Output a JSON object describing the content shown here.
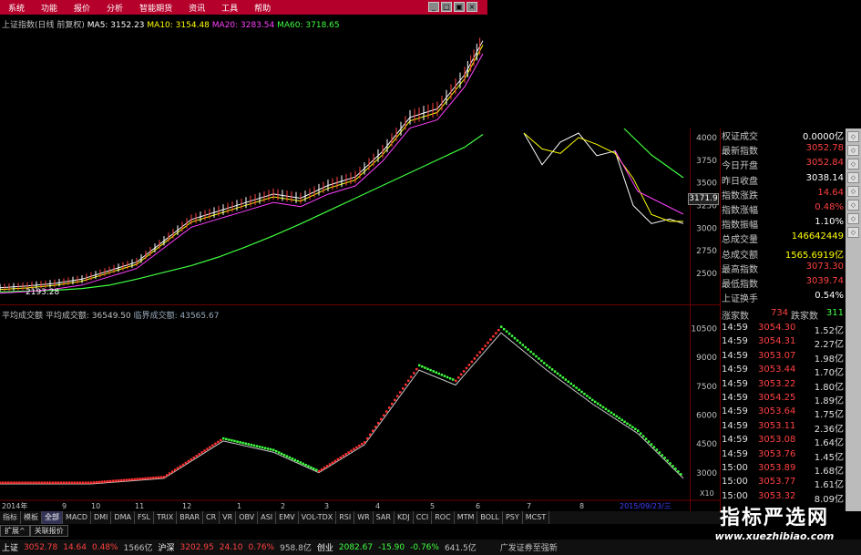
{
  "menu": [
    "系统",
    "功能",
    "报价",
    "分析",
    "智能期货",
    "资讯",
    "工具",
    "帮助"
  ],
  "main_legend": {
    "index": "上证指数(日线 前复权)",
    "ma5": "MA5: 3152.23",
    "ma10": "MA10: 3154.48",
    "ma20": "MA20: 3283.54",
    "ma60": "MA60: 3718.65",
    "low_label": "2193.28",
    "colors": {
      "ma5": "#ffffff",
      "ma10": "#ffff00",
      "ma20": "#ff40ff",
      "ma60": "#40ff40"
    }
  },
  "vol_legend": {
    "title": "平均成交额",
    "avg": "平均成交额: 36549.50",
    "lead": "临界成交额: 43565.67"
  },
  "price_axis": [
    "4000",
    "3750",
    "3500",
    "3250",
    "3000",
    "2750",
    "2500"
  ],
  "price_marker": "3171.9",
  "vol_axis": [
    "10500",
    "9000",
    "7500",
    "6000",
    "4500",
    "3000"
  ],
  "vol_axis_unit": "X10",
  "x_axis": [
    "2014年",
    "9",
    "10",
    "11",
    "12",
    "1",
    "2",
    "3",
    "4",
    "5",
    "6",
    "7",
    "8",
    "2015/09/23/三"
  ],
  "right_panel": [
    {
      "k": "权证成交",
      "v": "0.0000亿",
      "c": "#ffffff"
    },
    {
      "k": "最新指数",
      "v": "3052.78",
      "c": "#ff4040"
    },
    {
      "k": "今日开盘",
      "v": "3052.84",
      "c": "#ff4040"
    },
    {
      "k": "昨日收盘",
      "v": "3038.14",
      "c": "#ffffff"
    },
    {
      "k": "指数涨跌",
      "v": "14.64",
      "c": "#ff4040"
    },
    {
      "k": "指数涨幅",
      "v": "0.48%",
      "c": "#ff4040"
    },
    {
      "k": "指数振幅",
      "v": "1.10%",
      "c": "#ffffff"
    },
    {
      "k": "总成交量",
      "v": "146642449",
      "c": "#ffff00"
    },
    {
      "k": "总成交额",
      "v": "1565.6919亿",
      "c": "#ffff00"
    },
    {
      "k": "最高指数",
      "v": "3073.30",
      "c": "#ff4040"
    },
    {
      "k": "最低指数",
      "v": "3039.74",
      "c": "#ff4040"
    },
    {
      "k": "上证换手",
      "v": "0.54%",
      "c": "#ffffff"
    }
  ],
  "tick_head": {
    "up_label": "涨家数",
    "up": "734",
    "down_label": "跌家数",
    "down": "311"
  },
  "ticks": [
    {
      "t": "14:59",
      "p": "3054.30",
      "a": "1.52亿"
    },
    {
      "t": "14:59",
      "p": "3054.31",
      "a": "2.27亿"
    },
    {
      "t": "14:59",
      "p": "3053.07",
      "a": "1.98亿"
    },
    {
      "t": "14:59",
      "p": "3053.44",
      "a": "1.70亿"
    },
    {
      "t": "14:59",
      "p": "3053.22",
      "a": "1.80亿"
    },
    {
      "t": "14:59",
      "p": "3054.25",
      "a": "1.89亿"
    },
    {
      "t": "14:59",
      "p": "3053.64",
      "a": "1.75亿"
    },
    {
      "t": "14:59",
      "p": "3053.11",
      "a": "2.36亿"
    },
    {
      "t": "14:59",
      "p": "3053.08",
      "a": "1.64亿"
    },
    {
      "t": "14:59",
      "p": "3053.76",
      "a": "1.45亿"
    },
    {
      "t": "15:00",
      "p": "3053.89",
      "a": "1.68亿"
    },
    {
      "t": "15:00",
      "p": "3053.77",
      "a": "1.61亿"
    },
    {
      "t": "15:00",
      "p": "3053.32",
      "a": "8.09亿"
    }
  ],
  "tabs": [
    "指标",
    "模板",
    "全部",
    "MACD",
    "DMI",
    "DMA",
    "FSL",
    "TRIX",
    "BRAR",
    "CR",
    "VR",
    "OBV",
    "ASI",
    "EMV",
    "VOL-TDX",
    "RSI",
    "WR",
    "SAR",
    "KDJ",
    "CCI",
    "ROC",
    "MTM",
    "BOLL",
    "PSY",
    "MCST"
  ],
  "sub_tabs": [
    "扩展^",
    "关联报价"
  ],
  "status": [
    {
      "t": "上证",
      "c": "#ffffff"
    },
    {
      "t": "3052.78",
      "c": "#ff4040"
    },
    {
      "t": "14.64",
      "c": "#ff4040"
    },
    {
      "t": "0.48%",
      "c": "#ff4040"
    },
    {
      "t": "1566亿",
      "c": "#c0c0c0"
    },
    {
      "t": "沪深",
      "c": "#ffffff"
    },
    {
      "t": "3202.95",
      "c": "#ff4040"
    },
    {
      "t": "24.10",
      "c": "#ff4040"
    },
    {
      "t": "0.76%",
      "c": "#ff4040"
    },
    {
      "t": "958.8亿",
      "c": "#c0c0c0"
    },
    {
      "t": "创业",
      "c": "#ffffff"
    },
    {
      "t": "2082.67",
      "c": "#40ff40"
    },
    {
      "t": "-15.90",
      "c": "#40ff40"
    },
    {
      "t": "-0.76%",
      "c": "#40ff40"
    },
    {
      "t": "641.5亿",
      "c": "#c0c0c0"
    }
  ],
  "broker": "广发证券至强新",
  "watermark": {
    "cn": "指标严选网",
    "url": "www.xuezhibiao.com"
  },
  "chart_data": [
    {
      "type": "line",
      "name": "price",
      "x": [
        0,
        30,
        60,
        90,
        120,
        150,
        180,
        210,
        240,
        270,
        300,
        330,
        360,
        390,
        420,
        450,
        480,
        510,
        530
      ],
      "values": [
        2200,
        2220,
        2250,
        2300,
        2400,
        2500,
        2750,
        3000,
        3100,
        3200,
        3300,
        3250,
        3400,
        3500,
        3800,
        4200,
        4300,
        4700,
        5100
      ],
      "ma60": [
        2150,
        2160,
        2170,
        2190,
        2230,
        2300,
        2380,
        2460,
        2560,
        2680,
        2810,
        2950,
        3100,
        3250,
        3400,
        3550,
        3700,
        3850,
        4000
      ]
    },
    {
      "type": "line",
      "name": "price-continued",
      "x": [
        575,
        595,
        615,
        635,
        655,
        675,
        695,
        715,
        735,
        750
      ],
      "values": [
        4050,
        3700,
        3950,
        4050,
        3800,
        3850,
        3250,
        3050,
        3100,
        3050
      ],
      "ylim": [
        2500,
        4100
      ]
    },
    {
      "type": "line",
      "name": "average-turnover",
      "x": [
        0,
        100,
        180,
        245,
        300,
        350,
        400,
        460,
        500,
        550,
        600,
        650,
        700,
        750
      ],
      "values": [
        2500,
        2500,
        2800,
        4800,
        4200,
        3100,
        4600,
        8600,
        7800,
        10600,
        8600,
        6800,
        5200,
        2800
      ],
      "ylim": [
        2000,
        11000
      ]
    }
  ]
}
